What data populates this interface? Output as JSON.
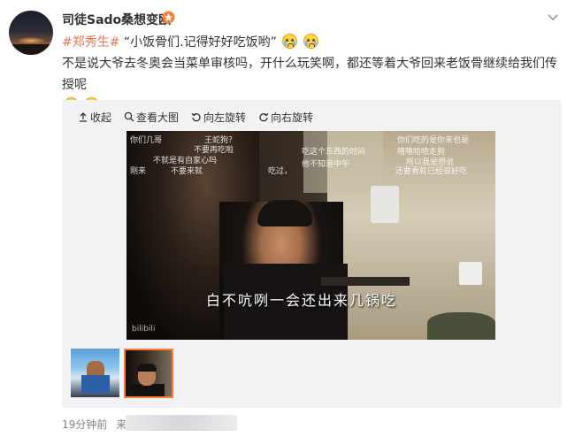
{
  "post": {
    "username": "司徒Sado桑想变欧",
    "topic": "#郑秀生#",
    "quote": "“小饭骨们.记得好好吃饭哟”",
    "body": "不是说大爷去冬奥会当菜单审核吗，开什么玩笑啊，都还等着大爷回来老饭骨继续给我们传授呢",
    "time": "19分钟前",
    "source_prefix": "来自"
  },
  "toolbar": {
    "collapse": "收起",
    "view_large": "查看大图",
    "rotate_left": "向左旋转",
    "rotate_right": "向右旋转"
  },
  "photo": {
    "subtitle": "白不吭咧一会还出来几锅吃",
    "watermark": "bilibili",
    "danmaku": [
      "你们几哥",
      "王蛇狗？",
      "不要再吃啦",
      "不就是有自家心吗",
      "刚来",
      "不要来就",
      "你们吃的是你来也是",
      "吃这个东西的时间",
      "嘻嘻哈哈走狗",
      "所以我是想说",
      "他不知道中午",
      "吃过，",
      "还要看就已经很好吃"
    ]
  },
  "colors": {
    "topic": "#eb7350",
    "vip": "#f5823c",
    "active_thumb_border": "#fa7d3c"
  }
}
